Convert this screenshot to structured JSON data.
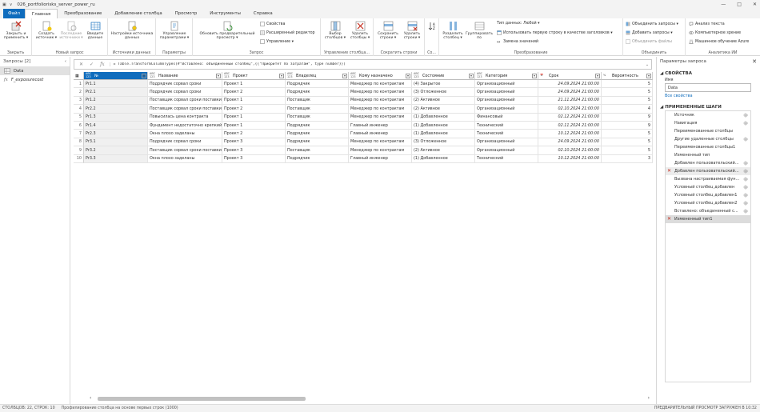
{
  "window": {
    "title": "026_portfoliorisks_server_power_ru",
    "controls": [
      "—",
      "□",
      "✕"
    ]
  },
  "tabs": [
    "Файл",
    "Главная",
    "Преобразование",
    "Добавление столбца",
    "Просмотр",
    "Инструменты",
    "Справка"
  ],
  "ribbon": {
    "groups": [
      {
        "name": "Закрыть",
        "buttons": [
          "Закрыть и применить ▾"
        ]
      },
      {
        "name": "Новый запрос",
        "buttons": [
          "Создать источник ▾",
          "Последние источники ▾",
          "Введите данные"
        ]
      },
      {
        "name": "Источники данных",
        "buttons": [
          "Настройки источника данных"
        ]
      },
      {
        "name": "Параметры",
        "buttons": [
          "Управление параметрами ▾"
        ]
      },
      {
        "name": "Запрос",
        "buttons": [
          "Обновить предварительный просмотр ▾"
        ],
        "small": [
          "Свойства",
          "Расширенный редактор",
          "Управление ▾"
        ]
      },
      {
        "name": "Управление столбца...",
        "buttons": [
          "Выбор столбцов ▾",
          "Удалить столбцы ▾"
        ]
      },
      {
        "name": "Сократить строки",
        "buttons": [
          "Сохранить строки ▾",
          "Удалить строки ▾"
        ]
      },
      {
        "name": "Со...",
        "buttons": [
          ""
        ]
      },
      {
        "name": "Преобразование",
        "buttons": [
          "Разделить столбец ▾",
          "Группировать по"
        ],
        "small": [
          "Тип данных: Любой ▾",
          "Использовать первую строку в качестве заголовков ▾",
          "Замена значений"
        ]
      },
      {
        "name": "Объединить",
        "small": [
          "Объединить запросы ▾",
          "Добавить запросы ▾",
          "Объединить файлы"
        ]
      },
      {
        "name": "Аналитика ИИ",
        "small": [
          "Анализ текста",
          "Компьютерное зрение",
          "Машинное обучение Azure"
        ]
      }
    ]
  },
  "left_pane": {
    "title": "Запросы [2]",
    "queries": [
      {
        "name": "Data",
        "selected": true,
        "icon": "table-icon"
      },
      {
        "name": "F_exposurecost",
        "selected": false,
        "icon": "function-icon"
      }
    ]
  },
  "formula": {
    "text": "= Table.TransformColumnTypes(#\"Вставлено: объединенный столбец\",{{\"Приоритет по затратам\", type number}})"
  },
  "grid": {
    "columns": [
      {
        "type": "ABC\n123",
        "name": "№",
        "selected": true
      },
      {
        "type": "ABC\n123",
        "name": "Название"
      },
      {
        "type": "ABC\n123",
        "name": "Проект"
      },
      {
        "type": "ABC\n123",
        "name": "Владелец"
      },
      {
        "type": "ABC\n123",
        "name": "Кому назначено"
      },
      {
        "type": "ABC\n123",
        "name": "Состояние"
      },
      {
        "type": "ABC\n123",
        "name": "Категория"
      },
      {
        "type": "📅",
        "name": "Срок"
      },
      {
        "type": "%",
        "name": "Вероятность"
      }
    ],
    "rows": [
      [
        "1",
        "Pr1.1",
        "Подрядчик сорвал сроки",
        "Проект 1",
        "Подрядчик",
        "Менеджер по контрактам",
        "(4) Закрытое",
        "Организационный",
        "24.09.2024 21:00:00",
        "5"
      ],
      [
        "2",
        "Pr2.1",
        "Подрядчик сорвал сроки",
        "Проект 2",
        "Подрядчик",
        "Менеджер по контрактам",
        "(3) Отложенное",
        "Организационный",
        "24.09.2024 21:00:00",
        "5"
      ],
      [
        "3",
        "Pr1.2",
        "Поставщик сорвал сроки поставки",
        "Проект 1",
        "Поставщик",
        "Менеджер по контрактам",
        "(2) Активное",
        "Организационный",
        "21.11.2024 21:00:00",
        "5"
      ],
      [
        "4",
        "Pr2.2",
        "Поставщик сорвал сроки поставки",
        "Проект 2",
        "Поставщик",
        "Менеджер по контрактам",
        "(2) Активное",
        "Организационный",
        "02.10.2024 21:00:00",
        "4"
      ],
      [
        "5",
        "Pr1.3",
        "Повысилась цена контракта",
        "Проект 1",
        "Поставщик",
        "Менеджер по контрактам",
        "(1) Добавленное",
        "Финансовый",
        "02.12.2024 21:00:00",
        "9"
      ],
      [
        "6",
        "Pr1.4",
        "Фундамент недостаточно крепкий",
        "Проект 1",
        "Подрядчик",
        "Главный инженер",
        "(1) Добавленное",
        "Технический",
        "02.11.2024 21:00:00",
        "9"
      ],
      [
        "7",
        "Pr2.3",
        "Окна плохо заделаны",
        "Проект 2",
        "Подрядчик",
        "Главный инженер",
        "(1) Добавленное",
        "Технический",
        "10.12.2024 21:00:00",
        "5"
      ],
      [
        "8",
        "Pr3.1",
        "Подрядчик сорвал сроки",
        "Проект 3",
        "Подрядчик",
        "Менеджер по контрактам",
        "(3) Отложенное",
        "Организационный",
        "24.09.2024 21:00:00",
        "5"
      ],
      [
        "9",
        "Pr3.2",
        "Поставщик сорвал сроки поставки",
        "Проект 3",
        "Поставщик",
        "Менеджер по контрактам",
        "(2) Активное",
        "Организационный",
        "02.10.2024 21:00:00",
        "5"
      ],
      [
        "10",
        "Pr3.3",
        "Окна плохо заделаны",
        "Проект 3",
        "Подрядчик",
        "Главный инженер",
        "(1) Добавленное",
        "Технический",
        "10.12.2024 21:00:00",
        "3"
      ]
    ]
  },
  "right_pane": {
    "title": "Параметры запроса",
    "properties_label": "СВОЙСТВА",
    "name_label": "Имя",
    "name_value": "Data",
    "all_properties": "Все свойства",
    "steps_label": "ПРИМЕНЕННЫЕ ШАГИ",
    "steps": [
      {
        "name": "Источник",
        "gear": true
      },
      {
        "name": "Навигация",
        "gear": true
      },
      {
        "name": "Переименованные столбцы",
        "gear": false
      },
      {
        "name": "Другие удаленные столбцы",
        "gear": true
      },
      {
        "name": "Переименованные столбцы1",
        "gear": false
      },
      {
        "name": "Измененный тип",
        "gear": false
      },
      {
        "name": "Добавлен пользовательский...",
        "gear": true
      },
      {
        "name": "Добавлен пользовательский...",
        "gear": true,
        "hl": true,
        "x": true
      },
      {
        "name": "Вызвана настраиваемая фун...",
        "gear": true
      },
      {
        "name": "Условный столбец добавлен",
        "gear": true
      },
      {
        "name": "Условный столбец добавлен1",
        "gear": true
      },
      {
        "name": "Условный столбец добавлен2",
        "gear": true
      },
      {
        "name": "Вставлено: объединенный с...",
        "gear": true
      },
      {
        "name": "Измененный тип1",
        "gear": false,
        "sel": true,
        "x": true
      }
    ]
  },
  "status": {
    "left": "СТОЛБЦОВ: 22, СТРОК: 10",
    "mid": "Профилирование столбца на основе первых строк (1000)",
    "right": "ПРЕДВАРИТЕЛЬНЫЙ ПРОСМОТР ЗАГРУЖЕН В 10:32"
  },
  "colors": {
    "accent": "#0f6cbd",
    "error": "#c42b1c"
  }
}
